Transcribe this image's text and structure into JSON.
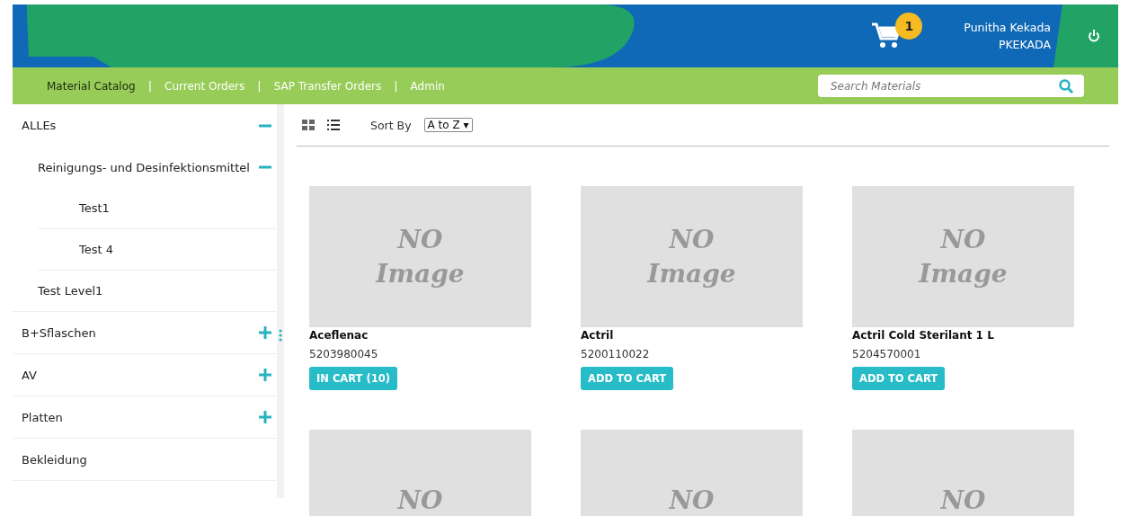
{
  "header": {
    "cart_count": "1",
    "user_name": "Punitha Kekada",
    "user_id": "PKEKADA"
  },
  "nav": {
    "items": [
      {
        "label": "Material Catalog",
        "selected": true
      },
      {
        "label": "Current Orders",
        "selected": false
      },
      {
        "label": "SAP Transfer Orders",
        "selected": false
      },
      {
        "label": "Admin",
        "selected": false
      }
    ],
    "separator": "|",
    "search": {
      "placeholder": "Search Materials"
    }
  },
  "sidebar": {
    "items": [
      {
        "label": "ALLEs",
        "expanded": true,
        "children": [
          {
            "label": "Reinigungs- und Desinfektionsmittel",
            "expanded": true,
            "children": [
              {
                "label": "Test1"
              },
              {
                "label": "Test 4"
              }
            ]
          },
          {
            "label": "Test Level1"
          }
        ]
      },
      {
        "label": "B+Sflaschen",
        "expanded": false
      },
      {
        "label": "AV",
        "expanded": false
      },
      {
        "label": "Platten",
        "expanded": false
      },
      {
        "label": "Bekleidung"
      }
    ]
  },
  "toolbar": {
    "sort_label": "Sort By",
    "sort_value": "A to Z ▾"
  },
  "products": [
    {
      "image_text": [
        "NO",
        "Image"
      ],
      "name": "Aceflenac",
      "number": "5203980045",
      "button": "IN CART (10)"
    },
    {
      "image_text": [
        "NO",
        "Image"
      ],
      "name": "Actril",
      "number": "5200110022",
      "button": "ADD TO CART"
    },
    {
      "image_text": [
        "NO",
        "Image"
      ],
      "name": "Actril Cold Sterilant 1 L",
      "number": "5204570001",
      "button": "ADD TO CART"
    },
    {
      "image_text": [
        "NO"
      ]
    },
    {
      "image_text": [
        "NO"
      ]
    },
    {
      "image_text": [
        "NO"
      ]
    }
  ]
}
